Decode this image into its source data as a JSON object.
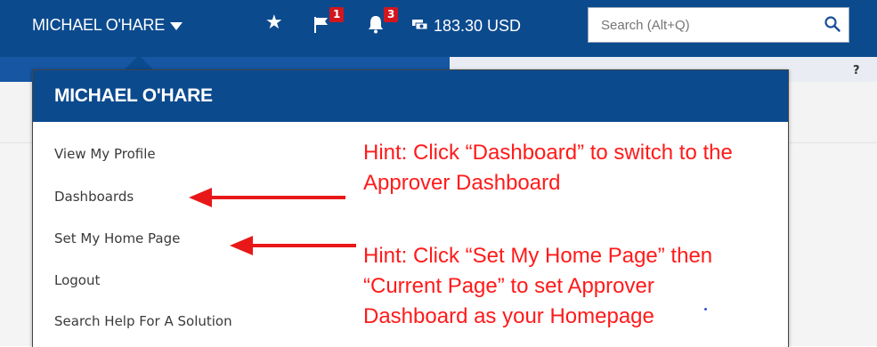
{
  "topbar": {
    "user_name": "MICHAEL O'HARE",
    "favorites_icon": "star-icon",
    "flag_icon": "flag-icon",
    "flag_count": "1",
    "bell_icon": "bell-icon",
    "bell_count": "3",
    "money_icon": "money-icon",
    "amount": "183.30 USD",
    "search_placeholder": "Search (Alt+Q)",
    "search_icon": "search-icon",
    "help_label": "?"
  },
  "user_menu": {
    "title": "MICHAEL O'HARE",
    "items": [
      {
        "label": "View My Profile"
      },
      {
        "label": "Dashboards"
      },
      {
        "label": "Set My Home Page"
      },
      {
        "label": "Logout"
      },
      {
        "label": "Search Help For A Solution"
      }
    ]
  },
  "hints": {
    "hint1_line1": "Hint: Click “Dashboard” to switch to the",
    "hint1_line2": "Approver Dashboard",
    "hint2_line1": "Hint: Click “Set My Home Page” then",
    "hint2_line2": "“Current Page” to set Approver",
    "hint2_line3": "Dashboard as your Homepage"
  },
  "colors": {
    "header_blue": "#0c4a8e",
    "badge_red": "#d1161e",
    "hint_red": "#ff1a1a"
  }
}
